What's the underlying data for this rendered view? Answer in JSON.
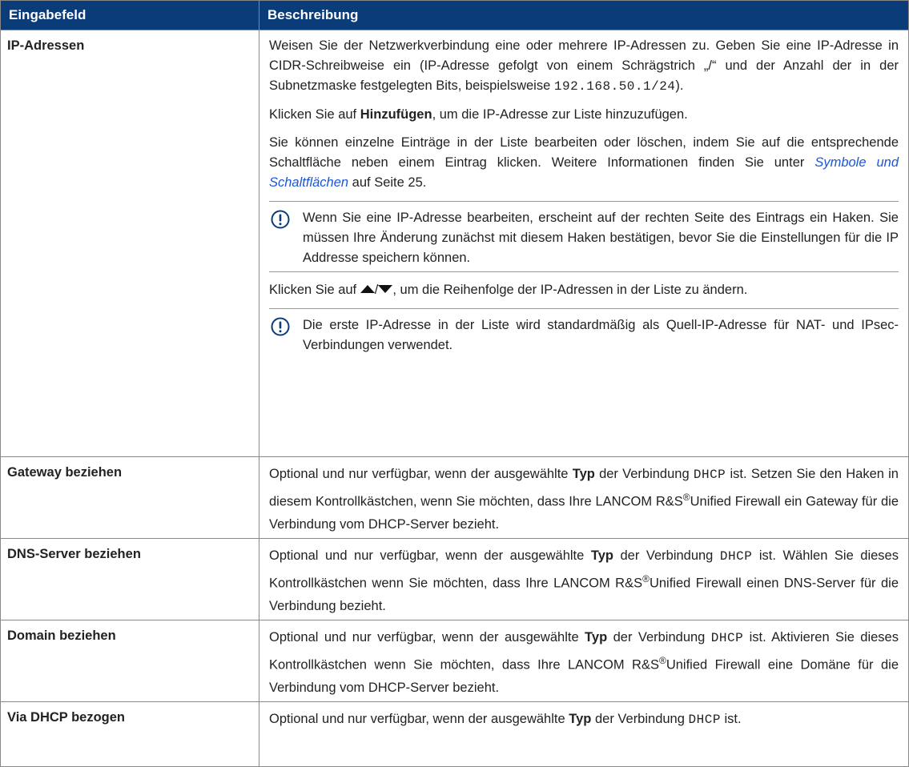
{
  "header": {
    "col1": "Eingabefeld",
    "col2": "Beschreibung"
  },
  "rows": [
    {
      "field": "IP-Adressen",
      "p1": "Weisen Sie der Netzwerkverbindung eine oder mehrere IP-Adressen zu. Geben Sie eine IP-Adresse in CIDR-Schreibweise ein (IP-Adresse gefolgt von einem Schrägstrich „/“ und der Anzahl der in der Subnetzmaske festgelegten Bits, beispielsweise",
      "p1_code": "192.168.50.1/24",
      "p1_end": ").",
      "p2_a": "Klicken Sie auf",
      "p2_bold": "Hinzufügen",
      "p2_b": ", um die IP-Adresse zur Liste hinzuzufügen.",
      "p3_a": "Sie können einzelne Einträge in der Liste bearbeiten oder löschen, indem Sie auf die entsprechende Schaltfläche neben einem Eintrag klicken. Weitere Informationen finden Sie unter",
      "p3_link": "Symbole und Schaltflächen",
      "p3_b": "auf Seite 25.",
      "note1": "Wenn Sie eine IP-Adresse bearbeiten, erscheint auf der rechten Seite des Eintrags ein Haken. Sie müssen Ihre Änderung zunächst mit diesem Haken bestätigen, bevor Sie die Einstellungen für die IP Addresse speichern können.",
      "p4_a": "Klicken Sie auf",
      "p4_sep": "/",
      "p4_b": ", um die Reihenfolge der IP-Adressen in der Liste zu ändern.",
      "note2": "Die erste IP-Adresse in der Liste wird standardmäßig als Quell-IP-Adresse für NAT- und IPsec-Verbindungen verwendet."
    },
    {
      "field": "Gateway beziehen",
      "a": "Optional und nur verfügbar, wenn der ausgewählte",
      "bold": "Typ",
      "b": "der Verbindung",
      "code": "DHCP",
      "c": "ist. Setzen Sie den Haken in diesem Kontrollkästchen, wenn Sie möchten, dass Ihre LANCOM R&S",
      "reg": "®",
      "d": "Unified Firewall ein Gateway für die Verbindung vom DHCP-Server bezieht."
    },
    {
      "field": "DNS-Server beziehen",
      "a": "Optional und nur verfügbar, wenn der ausgewählte",
      "bold": "Typ",
      "b": "der Verbindung",
      "code": "DHCP",
      "c": "ist. Wählen Sie dieses Kontrollkästchen wenn Sie möchten, dass Ihre LANCOM R&S",
      "reg": "®",
      "d": "Unified Firewall einen DNS-Server für die Verbindung bezieht."
    },
    {
      "field": "Domain beziehen",
      "a": "Optional und nur verfügbar, wenn der ausgewählte",
      "bold": "Typ",
      "b": "der Verbindung",
      "code": "DHCP",
      "c": "ist. Aktivieren Sie dieses Kontrollkästchen wenn Sie möchten, dass Ihre LANCOM R&S",
      "reg": "®",
      "d": "Unified Firewall eine Domäne für die Verbindung vom DHCP-Server bezieht."
    },
    {
      "field": "Via DHCP bezogen",
      "a": "Optional und nur verfügbar, wenn der ausgewählte",
      "bold": "Typ",
      "b": "der Verbindung",
      "code": "DHCP",
      "c": "ist."
    }
  ],
  "icons": {
    "note": "exclamation-circle-icon",
    "up": "triangle-up-icon",
    "down": "triangle-down-icon"
  },
  "colors": {
    "header_bg": "#0a3c7a",
    "link": "#1a56d6",
    "icon": "#0a3c7a"
  }
}
